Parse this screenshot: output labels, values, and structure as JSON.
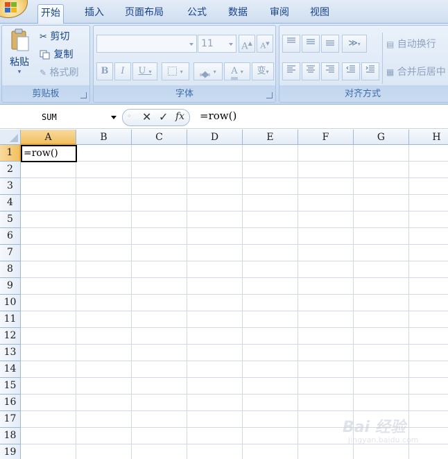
{
  "tabs": [
    {
      "label": "开始",
      "active": true
    },
    {
      "label": "插入",
      "active": false
    },
    {
      "label": "页面布局",
      "active": false
    },
    {
      "label": "公式",
      "active": false
    },
    {
      "label": "数据",
      "active": false
    },
    {
      "label": "审阅",
      "active": false
    },
    {
      "label": "视图",
      "active": false
    }
  ],
  "clipboard": {
    "label": "剪贴板",
    "paste": "粘贴",
    "cut": "剪切",
    "copy": "复制",
    "format_painter": "格式刷"
  },
  "font": {
    "label": "字体",
    "font_name": "",
    "font_size": "11",
    "grow": "A",
    "shrink": "A",
    "bold": "B",
    "italic": "I",
    "underline": "U",
    "color": "A",
    "phonetic": "变"
  },
  "alignment": {
    "label": "对齐方式",
    "wrap_text": "自动换行",
    "merge_center": "合并后居中"
  },
  "formula_bar": {
    "name_box": "SUM",
    "cancel": "✕",
    "enter": "✓",
    "fx": "fx",
    "content": "=row()"
  },
  "grid": {
    "columns": [
      "A",
      "B",
      "C",
      "D",
      "E",
      "F",
      "G",
      "H"
    ],
    "rows": [
      "1",
      "2",
      "3",
      "4",
      "5",
      "6",
      "7",
      "8",
      "9",
      "10",
      "11",
      "12",
      "13",
      "14",
      "15",
      "16",
      "17",
      "18",
      "19"
    ],
    "active_cell": {
      "col": "A",
      "row": "1",
      "value": "=row()"
    }
  },
  "watermark": {
    "line1": "Bai  经验",
    "line2": "jingyan.baidu.com"
  },
  "colors": {
    "ribbon": "#d2e0f2",
    "tab_text": "#15428b",
    "selection": "#f1c15f",
    "grid_line": "#d0d7e5"
  }
}
